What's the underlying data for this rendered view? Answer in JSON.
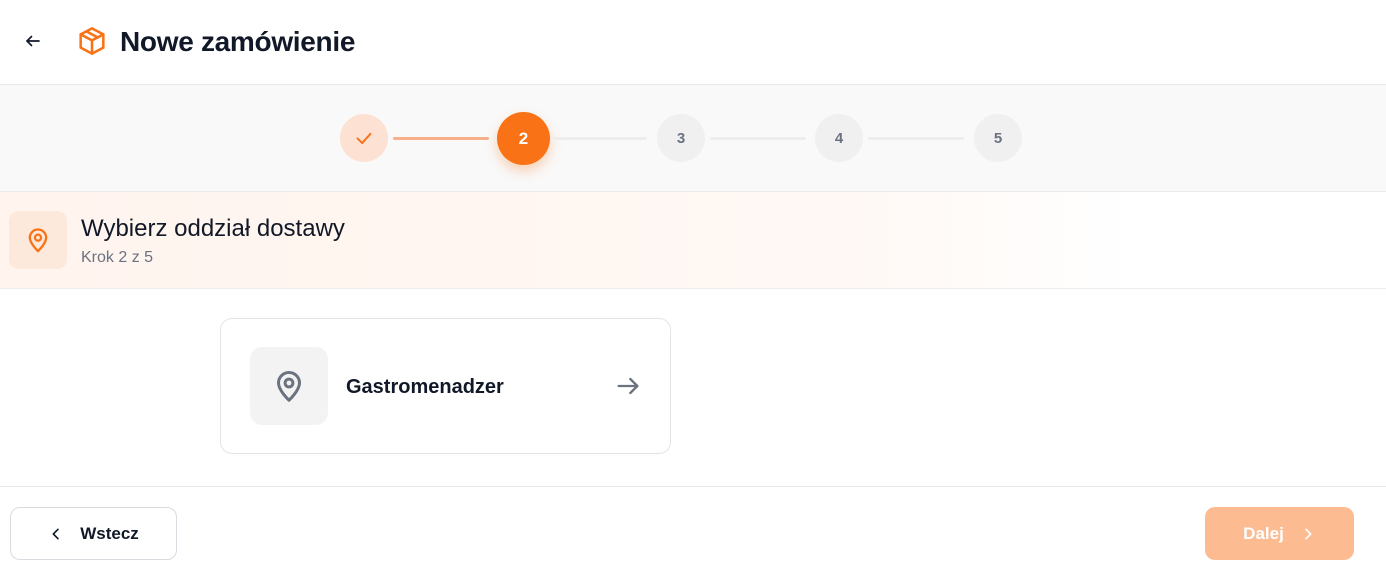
{
  "header": {
    "title": "Nowe zamówienie",
    "back_icon": "arrow-left-icon",
    "title_icon": "package-box-icon"
  },
  "stepper": {
    "steps": [
      {
        "label": "",
        "state": "completed",
        "icon": "check-icon"
      },
      {
        "label": "2",
        "state": "active"
      },
      {
        "label": "3",
        "state": "upcoming"
      },
      {
        "label": "4",
        "state": "upcoming"
      },
      {
        "label": "5",
        "state": "upcoming"
      }
    ],
    "current_step": 2,
    "total_steps": 5
  },
  "section": {
    "title": "Wybierz oddział dostawy",
    "subtitle": "Krok 2 z 5",
    "icon": "map-pin-icon"
  },
  "branches": [
    {
      "name": "Gastromenadzer",
      "icon": "map-pin-icon",
      "action_icon": "arrow-right-icon"
    }
  ],
  "footer": {
    "back_label": "Wstecz",
    "next_label": "Dalej",
    "next_disabled": true
  },
  "colors": {
    "accent": "#f97316",
    "accent_light": "#fde1d2",
    "accent_disabled": "#fdbb92",
    "text_primary": "#111827",
    "text_muted": "#6b7280"
  }
}
